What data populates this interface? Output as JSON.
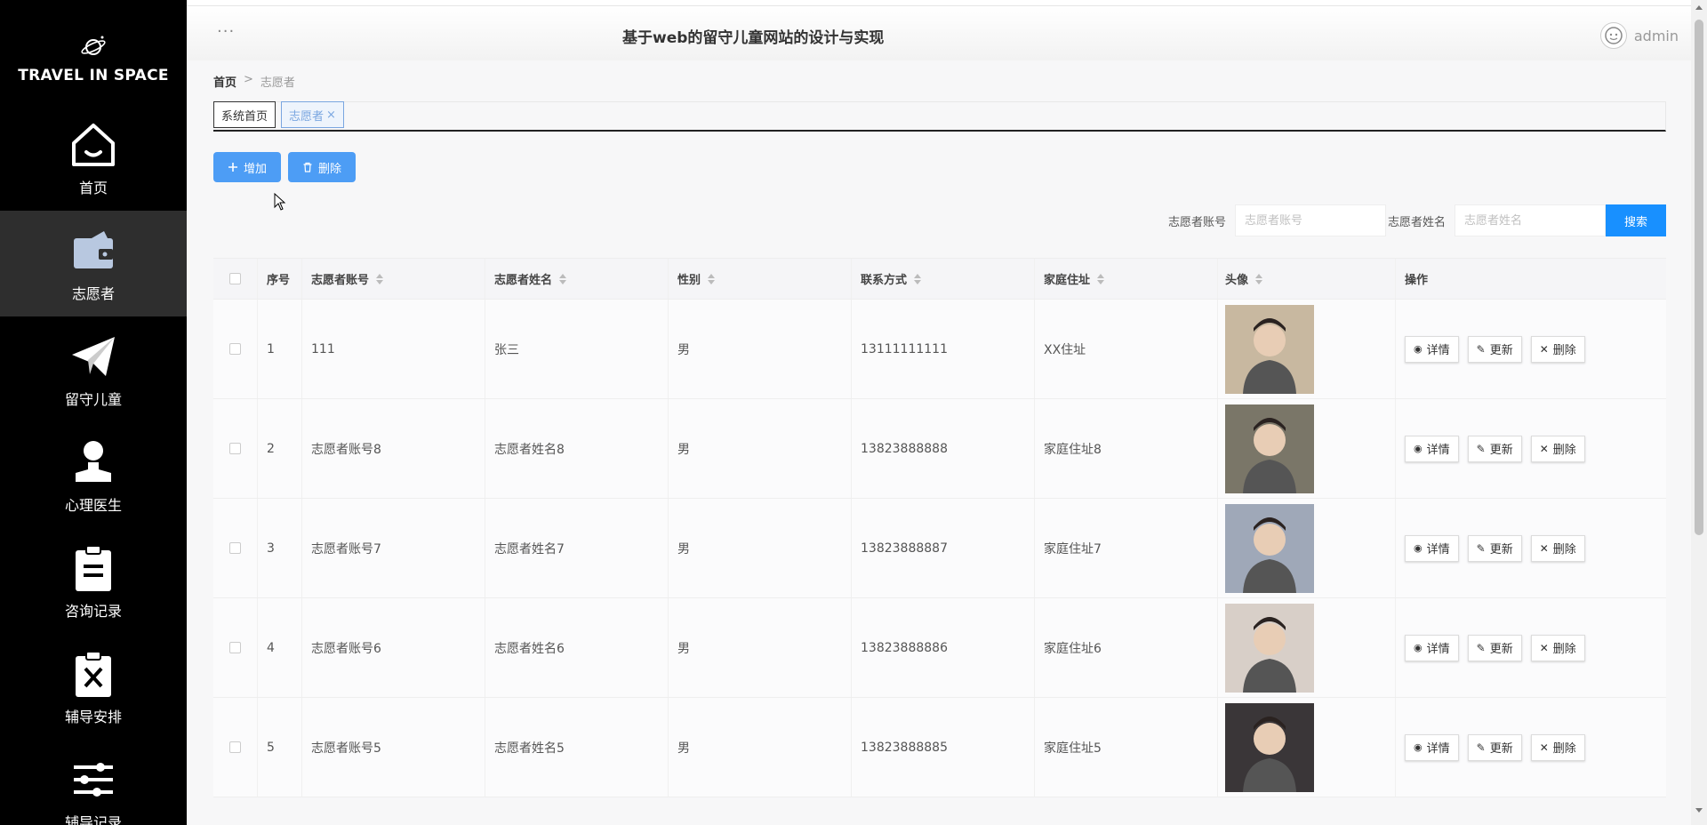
{
  "brand": {
    "name": "TRAVEL IN SPACE",
    "icon": "planet-icon"
  },
  "sidebar": {
    "items": [
      {
        "label": "首页",
        "icon": "home-icon",
        "active": false
      },
      {
        "label": "志愿者",
        "icon": "wallet-icon",
        "active": true
      },
      {
        "label": "留守儿童",
        "icon": "paper-plane-icon",
        "active": false
      },
      {
        "label": "心理医生",
        "icon": "user-icon",
        "active": false
      },
      {
        "label": "咨询记录",
        "icon": "clipboard-icon",
        "active": false
      },
      {
        "label": "辅导安排",
        "icon": "clipboard-x-icon",
        "active": false
      },
      {
        "label": "辅导记录",
        "icon": "sliders-icon",
        "active": false
      }
    ]
  },
  "header": {
    "menu_dots": "···",
    "title": "基于web的留守儿童网站的设计与实现",
    "username": "admin"
  },
  "breadcrumb": {
    "home": "首页",
    "separator": ">",
    "current": "志愿者"
  },
  "tabs": [
    {
      "label": "系统首页",
      "active": false
    },
    {
      "label": "志愿者",
      "active": true,
      "close": "×"
    }
  ],
  "toolbar": {
    "add_label": "增加",
    "delete_label": "删除"
  },
  "search": {
    "account_label": "志愿者账号",
    "account_placeholder": "志愿者账号",
    "name_label": "志愿者姓名",
    "name_placeholder": "志愿者姓名",
    "button_label": "搜索"
  },
  "table": {
    "headers": {
      "no": "序号",
      "account": "志愿者账号",
      "name": "志愿者姓名",
      "sex": "性别",
      "tel": "联系方式",
      "addr": "家庭住址",
      "avatar": "头像",
      "ops": "操作"
    },
    "actions": {
      "detail": "详情",
      "update": "更新",
      "delete": "删除"
    },
    "rows": [
      {
        "no": "1",
        "account": "111",
        "name": "张三",
        "sex": "男",
        "tel": "13111111111",
        "addr": "XX住址"
      },
      {
        "no": "2",
        "account": "志愿者账号8",
        "name": "志愿者姓名8",
        "sex": "男",
        "tel": "13823888888",
        "addr": "家庭住址8"
      },
      {
        "no": "3",
        "account": "志愿者账号7",
        "name": "志愿者姓名7",
        "sex": "男",
        "tel": "13823888887",
        "addr": "家庭住址7"
      },
      {
        "no": "4",
        "account": "志愿者账号6",
        "name": "志愿者姓名6",
        "sex": "男",
        "tel": "13823888886",
        "addr": "家庭住址6"
      },
      {
        "no": "5",
        "account": "志愿者账号5",
        "name": "志愿者姓名5",
        "sex": "男",
        "tel": "13823888885",
        "addr": "家庭住址5"
      }
    ]
  },
  "colors": {
    "primary": "#4d9df5",
    "search_button": "#1890ff",
    "sidebar_bg": "#000000",
    "sidebar_active": "#2e2e2e"
  }
}
